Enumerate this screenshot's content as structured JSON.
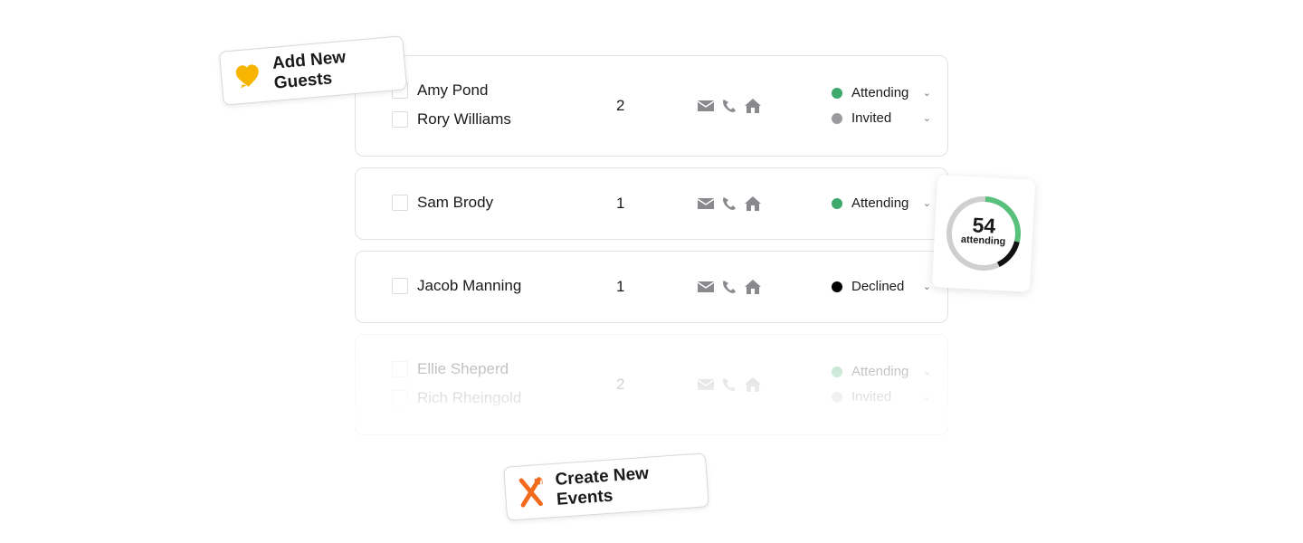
{
  "guest_groups": [
    {
      "guests": [
        {
          "name": "Amy Pond",
          "status": "Attending",
          "status_color": "#3daa6b"
        },
        {
          "name": "Rory Williams",
          "status": "Invited",
          "status_color": "#9a9a9f"
        }
      ],
      "count": "2"
    },
    {
      "guests": [
        {
          "name": "Sam Brody",
          "status": "Attending",
          "status_color": "#3daa6b"
        }
      ],
      "count": "1"
    },
    {
      "guests": [
        {
          "name": "Jacob Manning",
          "status": "Declined",
          "status_color": "#000000"
        }
      ],
      "count": "1"
    },
    {
      "guests": [
        {
          "name": "Ellie Sheperd",
          "status": "Attending",
          "status_color": "#3daa6b"
        },
        {
          "name": "Rich Rheingold",
          "status": "Invited",
          "status_color": "#9a9a9f"
        }
      ],
      "count": "2"
    }
  ],
  "badges": {
    "add_guests": "Add New Guests",
    "create_events": "Create New Events"
  },
  "summary": {
    "count": "54",
    "label": "attending",
    "attending_fraction": 0.28,
    "declined_fraction": 0.14,
    "colors": {
      "attending": "#57c07a",
      "declined": "#111111",
      "other": "#cfcfd2"
    }
  }
}
